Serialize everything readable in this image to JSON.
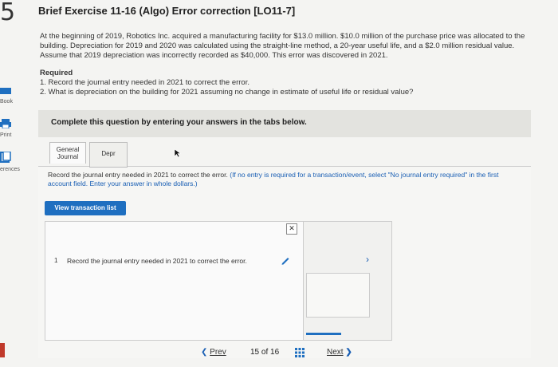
{
  "question_number": "5",
  "sidebar": {
    "book_label": "Book",
    "print_label": "Print",
    "references_label": "erences"
  },
  "title": "Brief Exercise 11-16 (Algo) Error correction [LO11-7]",
  "description": "At the beginning of 2019, Robotics Inc. acquired a manufacturing facility for $13.0 million. $10.0 million of the purchase price was allocated to the building. Depreciation for 2019 and 2020 was calculated using the straight-line method, a 20-year useful life, and a $2.0 million residual value. Assume that 2019 depreciation was incorrectly recorded as $40,000. This error was discovered in 2021.",
  "required": {
    "heading": "Required",
    "item1": "1. Record the journal entry needed in 2021 to correct the error.",
    "item2": "2. What is depreciation on the building for 2021 assuming no change in estimate of useful life or residual value?"
  },
  "banner_text": "Complete this question by entering your answers in the tabs below.",
  "tabs": {
    "tab1_line1": "General",
    "tab1_line2": "Journal",
    "tab2": "Depr"
  },
  "instruction": {
    "main": "Record the journal entry needed in 2021 to correct the error.",
    "note": "(If no entry is required for a transaction/event, select \"No journal entry required\" in the first account field. Enter your answer in whole dollars.)"
  },
  "view_transaction_button": "View transaction list",
  "close_glyph": "✕",
  "row": {
    "number": "1",
    "text": "Record the journal entry needed in 2021 to correct the error."
  },
  "pagination": {
    "prev_label": "Prev",
    "page_text": "15 of 16",
    "next_label": "Next"
  },
  "colors": {
    "accent": "#1f6fc0",
    "banner": "#e3e3df"
  }
}
